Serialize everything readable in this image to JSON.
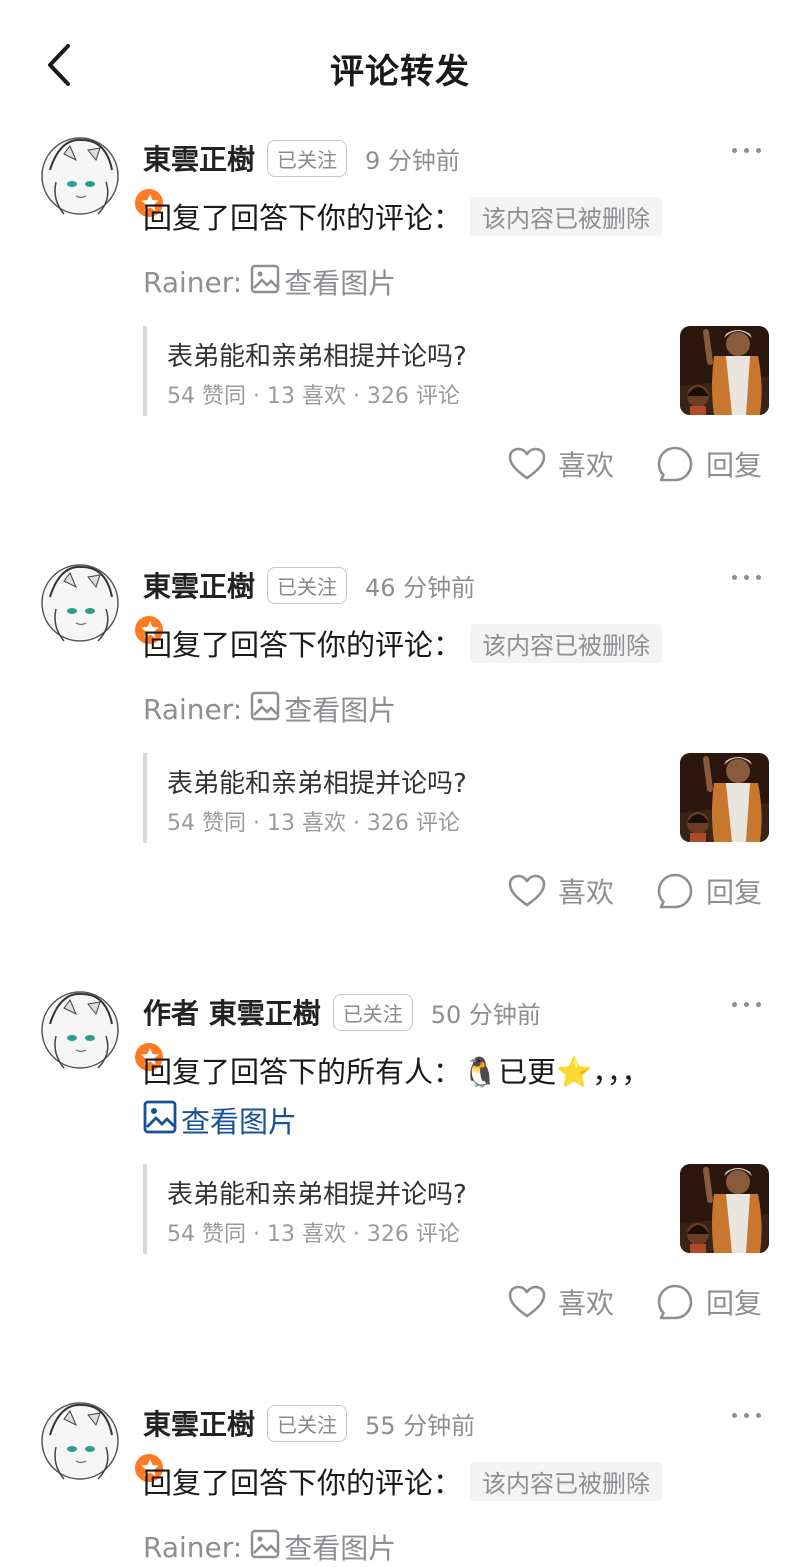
{
  "header": {
    "title": "评论转发",
    "back_icon": "chevron-left-icon"
  },
  "colors": {
    "badge": "#ff7a21",
    "link": "#175199",
    "muted": "#8e8e93"
  },
  "comments": [
    {
      "author": "東雲正樹",
      "follow_label": "已关注",
      "time": "9 分钟前",
      "reply_text": "回复了回答下你的评论：",
      "deleted_text": "该内容已被删除",
      "sub_name": "Rainer:",
      "view_image_label": "查看图片",
      "quote": {
        "title": "表弟能和亲弟相提并论吗?",
        "meta": "54 赞同 · 13 喜欢 · 326 评论"
      },
      "like_label": "喜欢",
      "reply_label": "回复"
    },
    {
      "author": "東雲正樹",
      "follow_label": "已关注",
      "time": "46 分钟前",
      "reply_text": "回复了回答下你的评论：",
      "deleted_text": "该内容已被删除",
      "sub_name": "Rainer:",
      "view_image_label": "查看图片",
      "quote": {
        "title": "表弟能和亲弟相提并论吗?",
        "meta": "54 赞同 · 13 喜欢 · 326 评论"
      },
      "like_label": "喜欢",
      "reply_label": "回复"
    },
    {
      "author": "作者 東雲正樹",
      "follow_label": "已关注",
      "time": "50 分钟前",
      "reply_text": "回复了回答下的所有人：🐧已更⭐，，，",
      "view_image_label": "查看图片",
      "quote": {
        "title": "表弟能和亲弟相提并论吗?",
        "meta": "54 赞同 · 13 喜欢 · 326 评论"
      },
      "like_label": "喜欢",
      "reply_label": "回复"
    },
    {
      "author": "東雲正樹",
      "follow_label": "已关注",
      "time": "55 分钟前",
      "reply_text": "回复了回答下你的评论：",
      "deleted_text": "该内容已被删除",
      "sub_name": "Rainer:",
      "view_image_label": "查看图片"
    }
  ]
}
